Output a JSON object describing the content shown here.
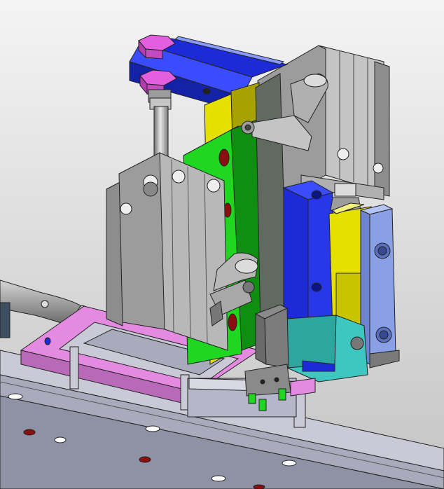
{
  "viewport": {
    "background_top": "#f4f4f4",
    "background_bottom": "#c4c4c4"
  },
  "colors": {
    "rail_light": "#c9cad6",
    "rail_mid": "#a9abbd",
    "rail_dark": "#7e8096",
    "base_plate": "#7f8c70",
    "base_plate_dark": "#5b6550",
    "cylinder_grey": "#9c9c9c",
    "cylinder_light": "#c4c4c4",
    "cylinder_dark": "#6a6a6a",
    "clamp_blue": "#1c2bd6",
    "clamp_blue_light": "#3b4cff",
    "magenta": "#e45fe0",
    "magenta_dark": "#b23cb0",
    "green": "#1fd620",
    "green_dark": "#0f8e12",
    "yellow": "#e6e000",
    "yellow_dark": "#a8a200",
    "light_blue": "#8aa0e6",
    "teal": "#3ec6c0",
    "pink_frame": "#e48ae0",
    "pink_frame_dark": "#b86ab8",
    "hole_red": "#8a1010"
  },
  "parts": [
    "top-clamp-bar",
    "hex-nut-top",
    "piston-rod",
    "left-cylinder-body",
    "rear-cylinder-body",
    "yellow-mount-plate",
    "green-slide-plate",
    "blue-vertical-bar",
    "yellow-slide-block",
    "light-blue-end-plate",
    "teal-bracket",
    "gripper-head",
    "pink-frame",
    "linear-rail",
    "base-plate",
    "air-fitting-upper",
    "air-fitting-lower",
    "air-hose-left"
  ]
}
